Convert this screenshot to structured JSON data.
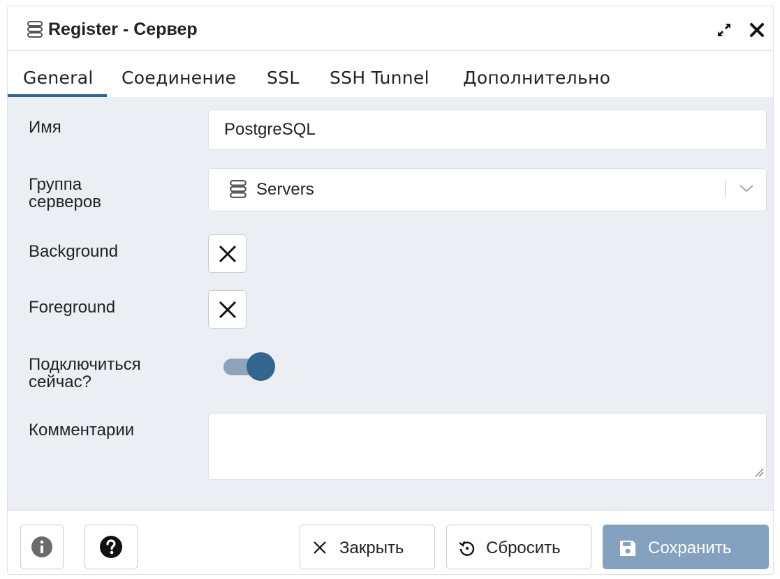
{
  "dialog": {
    "title": "Register - Сервер",
    "title_icon": "server-icon",
    "expand_icon": "expand-icon",
    "close_icon": "close-icon"
  },
  "tabs": [
    {
      "label": "General",
      "active": true
    },
    {
      "label": "Соединение",
      "active": false
    },
    {
      "label": "SSL",
      "active": false
    },
    {
      "label": "SSH Tunnel",
      "active": false
    },
    {
      "label": "Дополнительно",
      "active": false
    }
  ],
  "form": {
    "name_label": "Имя",
    "name_value": "PostgreSQL",
    "group_label_line1": "Группа",
    "group_label_line2": "серверов",
    "group_value": "Servers",
    "background_label": "Background",
    "foreground_label": "Foreground",
    "connect_label_line1": "Подключиться",
    "connect_label_line2": "сейчас?",
    "connect_now": true,
    "comments_label": "Комментарии",
    "comments_value": ""
  },
  "footer": {
    "info_icon": "info-icon",
    "help_icon": "question-icon",
    "close_label": "Закрыть",
    "reset_label": "Сбросить",
    "save_label": "Сохранить"
  },
  "colors": {
    "accent": "#326690",
    "toggle_track": "#8ea3bc",
    "save_button": "#84a2bf",
    "panel_bg": "#ebeef3"
  }
}
